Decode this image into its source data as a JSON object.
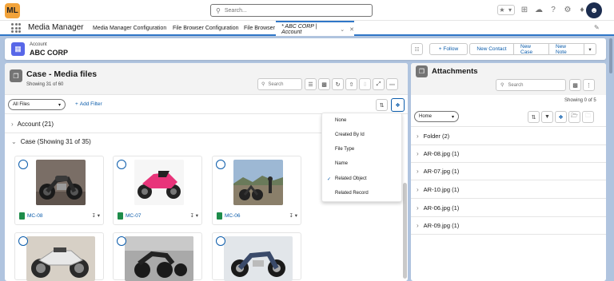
{
  "global": {
    "logo_text": "ML",
    "search_placeholder": "Search..."
  },
  "nav": {
    "app_name": "Media Manager",
    "items": [
      "Media Manager Configuration",
      "File Browser Configuration",
      "File Browser"
    ],
    "active_tab": "* ABC CORP | Account"
  },
  "record": {
    "type": "Account",
    "name": "ABC CORP",
    "follow_label": "+ Follow",
    "actions": [
      "New Contact",
      "New Case",
      "New Note"
    ]
  },
  "left": {
    "title": "Case - Media files",
    "count": "Showing 31 of 60",
    "search_placeholder": "Search",
    "filter_value": "All Files",
    "add_filter": "Add Filter",
    "groups": [
      "Account (21)",
      "Case (Showing 31 of 35)"
    ],
    "files": [
      {
        "name": "MC-08"
      },
      {
        "name": "MC-07"
      },
      {
        "name": "MC-06"
      }
    ]
  },
  "menu": {
    "items": [
      "None",
      "Created By Id",
      "File Type",
      "Name",
      "Related Object",
      "Related Record"
    ],
    "selected": "Related Object"
  },
  "right": {
    "title": "Attachments",
    "search_placeholder": "Search",
    "count": "Showing 0 of 5",
    "location": "Home",
    "folders": [
      "Folder (2)",
      "AR-08.jpg (1)",
      "AR-07.jpg (1)",
      "AR-10.jpg (1)",
      "AR-06.jpg (1)",
      "AR-09.jpg (1)"
    ]
  },
  "colors": {
    "brand": "#0b5cab",
    "accent": "#2f76c7",
    "account_icon": "#5867e8",
    "logo": "#f2a33a",
    "file_icon": "#1e8c4a"
  }
}
